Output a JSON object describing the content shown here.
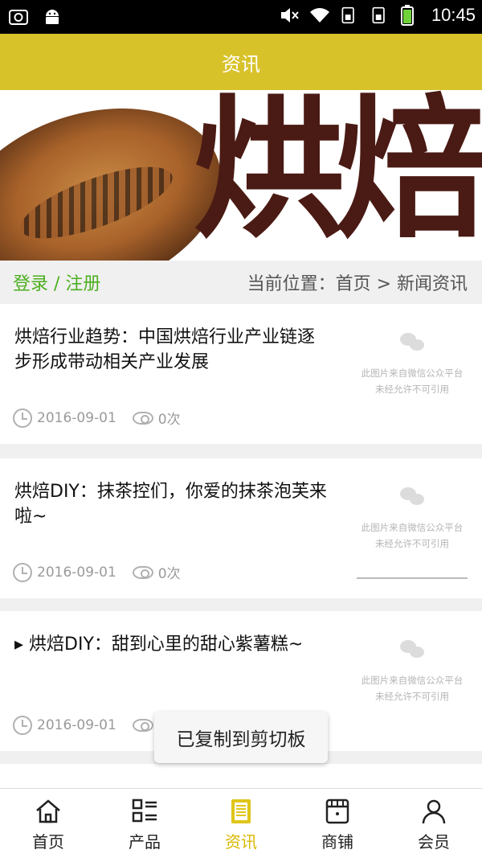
{
  "status_bar": {
    "time": "10:45"
  },
  "header": {
    "title": "资讯"
  },
  "banner": {
    "word": "烘焙"
  },
  "locbar": {
    "login": "登录 / 注册",
    "crumb": "当前位置：首页 > 新闻资讯"
  },
  "news": [
    {
      "title": "烘焙行业趋势：中国烘焙行业产业链逐步形成带动相关产业发展",
      "date": "2016-09-01",
      "views": "0次",
      "thumb_line1": "此图片来自微信公众平台",
      "thumb_line2": "未经允许不可引用"
    },
    {
      "title": "烘焙DIY：抹茶控们，你爱的抹茶泡芙来啦~",
      "date": "2016-09-01",
      "views": "0次",
      "thumb_line1": "此图片来自微信公众平台",
      "thumb_line2": "未经允许不可引用"
    },
    {
      "title": "▸ 烘焙DIY：甜到心里的甜心紫薯糕~",
      "date": "2016-09-01",
      "views": "",
      "thumb_line1": "此图片来自微信公众平台",
      "thumb_line2": "未经允许不可引用"
    }
  ],
  "toast": "已复制到剪切板",
  "tabs": [
    {
      "label": "首页",
      "icon": "home-icon"
    },
    {
      "label": "产品",
      "icon": "list-icon"
    },
    {
      "label": "资讯",
      "icon": "news-icon",
      "active": true
    },
    {
      "label": "商铺",
      "icon": "store-icon"
    },
    {
      "label": "会员",
      "icon": "user-icon"
    }
  ],
  "colors": {
    "accent": "#d8c22a",
    "login": "#4caf1f",
    "active_tab": "#d8b800"
  }
}
